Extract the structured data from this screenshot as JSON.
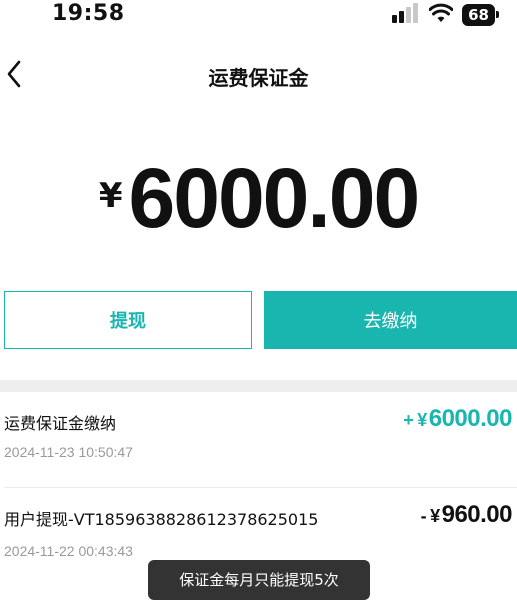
{
  "status_bar": {
    "time": "19:58",
    "battery": "68"
  },
  "nav": {
    "title": "运费保证金"
  },
  "balance": {
    "currency": "¥",
    "amount": "6000.00"
  },
  "actions": {
    "withdraw_label": "提现",
    "pay_label": "去缴纳"
  },
  "records": [
    {
      "title": "运费保证金缴纳",
      "time": "2024-11-23 10:50:47",
      "sign": "+",
      "currency": "¥",
      "amount": "6000.00"
    },
    {
      "title": "用户提现-VT1859638828612378625015",
      "time": "2024-11-22 00:43:43",
      "sign": "-",
      "currency": "¥",
      "amount": "960.00"
    }
  ],
  "toast": {
    "text": "保证金每月只能提现5次"
  },
  "colors": {
    "accent": "#19b6b0",
    "divider": "#eeeeee",
    "muted_text": "#9a9a9a"
  }
}
